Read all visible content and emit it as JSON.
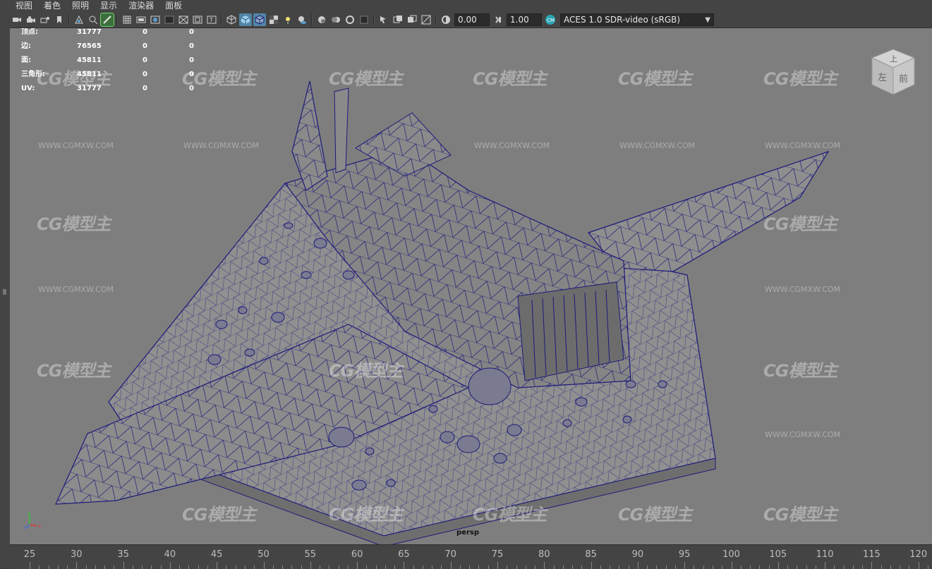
{
  "menu": {
    "items": [
      "视图",
      "着色",
      "照明",
      "显示",
      "渲染器",
      "面板"
    ]
  },
  "toolbar": {
    "exposure_value": "0.00",
    "gamma_value": "1.00",
    "color_space": "ACES 1.0 SDR-video (sRGB)",
    "icons": [
      "camera-select-icon",
      "camera-attributes-icon",
      "bookmark-icon",
      "image-plane-icon",
      "grease-pencil-icon",
      "grid-icon",
      "film-gate-icon",
      "resolution-gate-icon",
      "gate-mask-icon",
      "field-chart-icon",
      "safe-action-icon",
      "safe-title-icon",
      "wireframe-icon",
      "smooth-shade-icon",
      "wireframe-on-shaded-icon",
      "textured-icon",
      "use-all-lights-icon",
      "shadows-icon",
      "screen-space-ao-icon",
      "motion-blur-icon",
      "anti-aliasing-icon",
      "depth-of-field-icon",
      "isolate-select-icon",
      "xray-icon",
      "xray-joints-icon",
      "backface-icon",
      "exposure-icon",
      "gamma-icon",
      "color-management-icon"
    ]
  },
  "hud": {
    "rows": [
      {
        "label": "顶点:",
        "v1": "31777",
        "v2": "0",
        "v3": "0"
      },
      {
        "label": "边:",
        "v1": "76565",
        "v2": "0",
        "v3": "0"
      },
      {
        "label": "面:",
        "v1": "45811",
        "v2": "0",
        "v3": "0"
      },
      {
        "label": "三角形:",
        "v1": "45811",
        "v2": "0",
        "v3": "0"
      },
      {
        "label": "UV:",
        "v1": "31777",
        "v2": "0",
        "v3": "0"
      }
    ]
  },
  "viewport": {
    "camera_label": "persp",
    "viewcube": {
      "top": "上",
      "left": "左",
      "front": "前"
    },
    "watermark_text": "CG模型主",
    "watermark_url": "WWW.CGMXW.COM",
    "axis_labels": {
      "x": "x",
      "y": "y",
      "z": "z"
    }
  },
  "timeline": {
    "ticks": [
      "25",
      "30",
      "35",
      "40",
      "45",
      "50",
      "55",
      "60",
      "65",
      "70",
      "75",
      "80",
      "85",
      "90",
      "95",
      "100",
      "105",
      "110",
      "115",
      "120"
    ]
  },
  "colors": {
    "viewport_bg": "#7e7e7e",
    "wire": "#1c1a7a",
    "ui_bg": "#444444",
    "active_blue": "#5285a6"
  }
}
